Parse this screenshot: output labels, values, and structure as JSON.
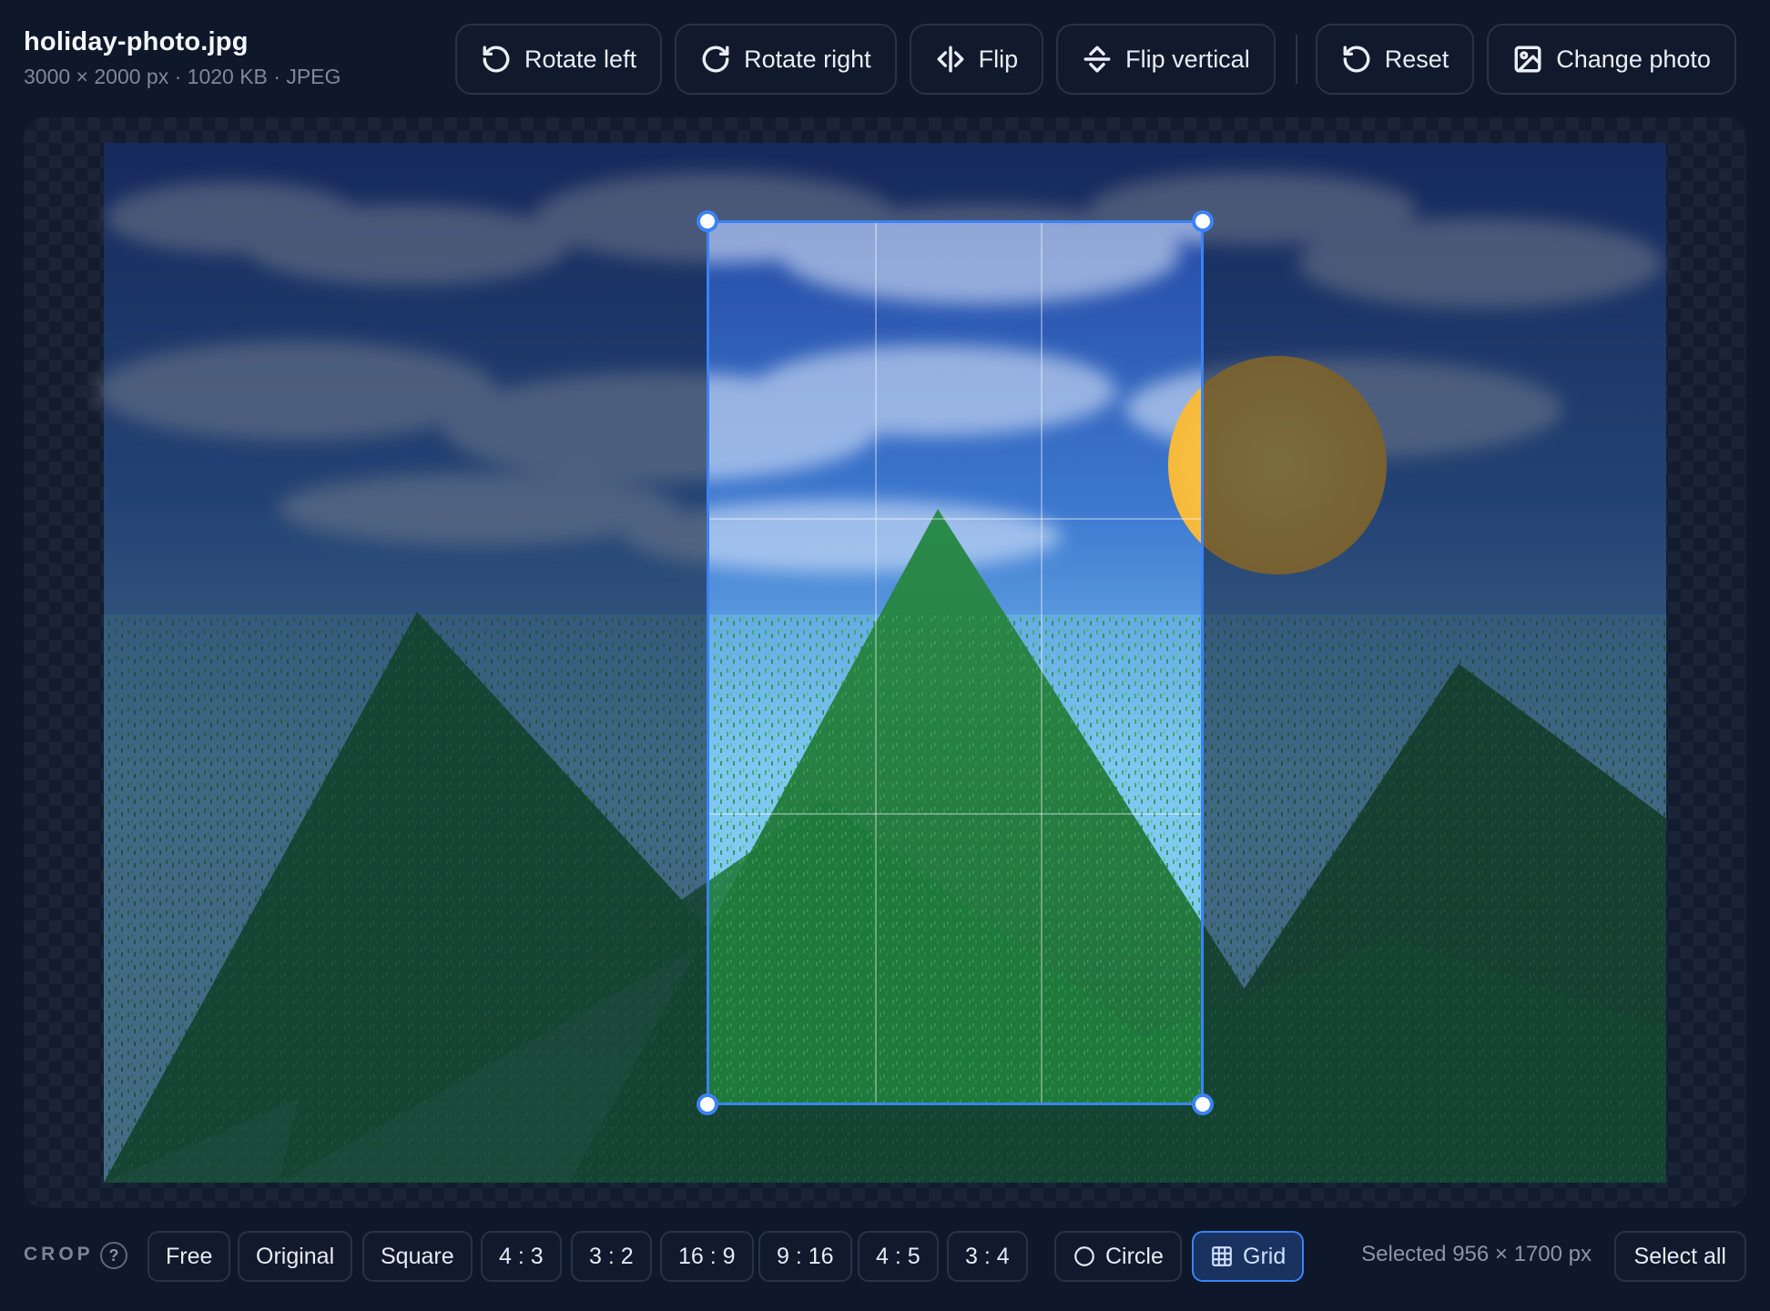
{
  "file": {
    "name": "holiday-photo.jpg",
    "meta": "3000 × 2000 px · 1020 KB · JPEG"
  },
  "toolbar": {
    "rotate_left": "Rotate left",
    "rotate_right": "Rotate right",
    "flip": "Flip",
    "flip_vertical": "Flip vertical",
    "reset": "Reset",
    "change_photo": "Change photo"
  },
  "crop": {
    "label": "CROP",
    "help": "?",
    "presets": [
      "Free",
      "Original",
      "Square",
      "4 : 3",
      "3 : 2",
      "16 : 9",
      "9 : 16",
      "4 : 5",
      "3 : 4"
    ],
    "circle_label": "Circle",
    "grid_label": "Grid",
    "grid_enabled": true,
    "circle_enabled": false,
    "selected_text": "Selected 956 × 1700 px",
    "select_all": "Select all"
  },
  "icons": {
    "rotate_left": "rotate-ccw-icon",
    "rotate_right": "rotate-cw-icon",
    "flip": "flip-horizontal-icon",
    "flip_vertical": "flip-vertical-icon",
    "reset": "reset-icon",
    "change_photo": "image-icon",
    "circle": "circle-icon",
    "grid": "grid-icon"
  },
  "colors": {
    "accent": "#3b82f6",
    "background": "#0f172a"
  }
}
